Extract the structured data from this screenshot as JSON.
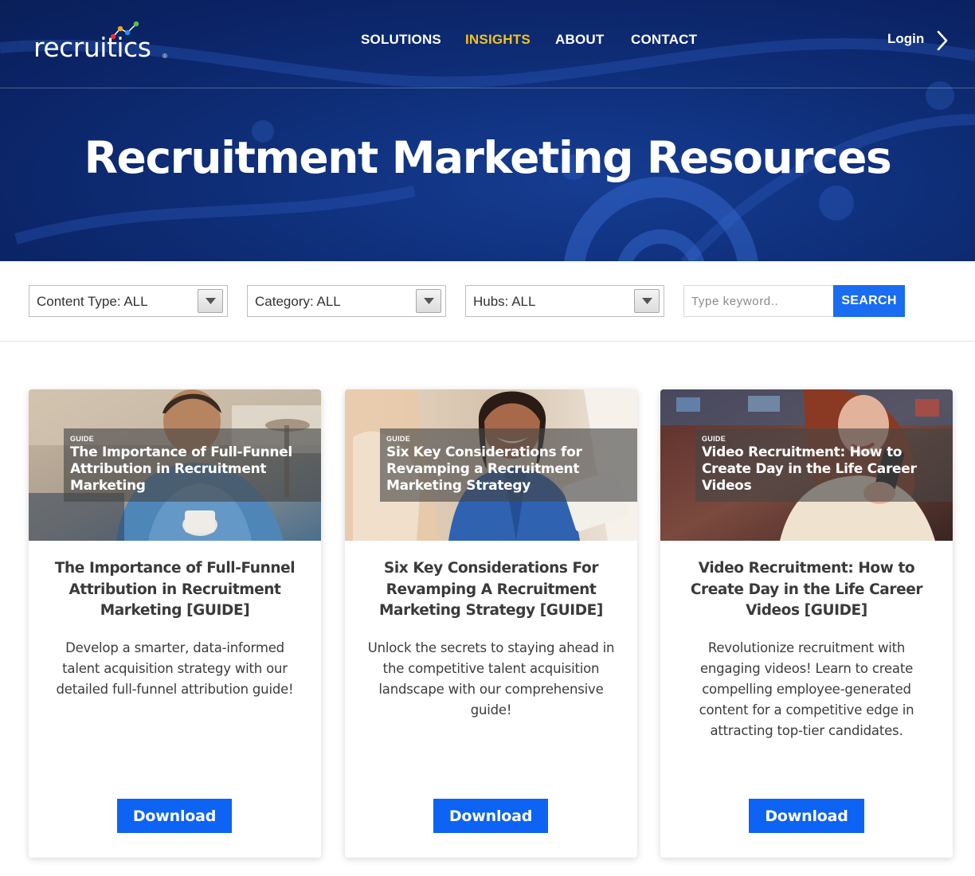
{
  "brand": {
    "logo_text": "recruitics",
    "registered_mark": "®",
    "accent": "#1a6cf0"
  },
  "nav": {
    "items": [
      {
        "label": "SOLUTIONS",
        "active": false
      },
      {
        "label": "INSIGHTS",
        "active": true
      },
      {
        "label": "ABOUT",
        "active": false
      },
      {
        "label": "CONTACT",
        "active": false
      }
    ],
    "active_color": "#f4c21f",
    "login_label": "Login",
    "login_icon": "chevron-right-icon"
  },
  "hero": {
    "title": "Recruitment Marketing Resources"
  },
  "filters": {
    "content_type": "Content Type: ALL",
    "category": "Category: ALL",
    "hubs": "Hubs: ALL",
    "dropdown_icon": "caret-down-icon",
    "search_placeholder": "Type keyword..",
    "search_value": "",
    "search_button": "SEARCH"
  },
  "cards": [
    {
      "tag": "GUIDE",
      "image_title": "The Importance of Full-Funnel Attribution in Recruitment Marketing",
      "title": "The Importance of Full-Funnel Attribution in Recruitment Marketing [GUIDE]",
      "description": "Develop a smarter, data-informed talent acquisition strategy with our detailed full-funnel attribution guide!",
      "button": "Download"
    },
    {
      "tag": "GUIDE",
      "image_title": "Six Key Considerations for Revamping a Recruitment Marketing Strategy",
      "title": "Six Key Considerations For Revamping A Recruitment Marketing Strategy [GUIDE]",
      "description": "Unlock the secrets to staying ahead in the competitive talent acquisition landscape with our comprehensive guide!",
      "button": "Download"
    },
    {
      "tag": "GUIDE",
      "image_title": "Video Recruitment: How to Create Day in the Life Career Videos",
      "title": "Video Recruitment: How to Create Day in the Life Career Videos [GUIDE]",
      "description": "Revolutionize recruitment with engaging videos! Learn to create compelling employee-generated content for a competitive edge in attracting top-tier candidates.",
      "button": "Download"
    }
  ]
}
